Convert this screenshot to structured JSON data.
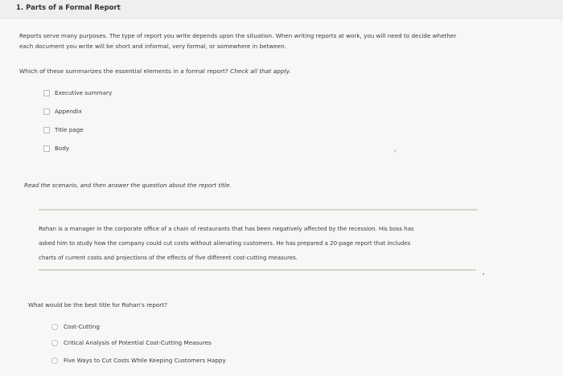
{
  "header": {
    "title": "1. Parts of a Formal Report"
  },
  "intro": {
    "line1": "Reports serve many purposes. The type of report you write depends upon the situation. When writing reports at work, you will need to decide whether",
    "line2": "each document you write will be short and informal, very formal, or somewhere in between."
  },
  "question1": {
    "prompt": "Which of these summarizes the essential elements in a formal report?",
    "hint": "Check all that apply.",
    "options": [
      "Executive summary",
      "Appendix",
      "Title page",
      "Body"
    ]
  },
  "instructions": "Read the scenario, and then answer the question about the report title.",
  "scenario": {
    "line1": "Rohan is a manager in the corporate office of a chain of restaurants that has been negatively affected by the recession. His boss has",
    "line2": "asked him to study how the company could cut costs without alienating customers. He has prepared a 20-page report that includes",
    "line3": "charts of current costs and projections of the effects of five different cost-cutting measures."
  },
  "question2": {
    "prompt": "What would be the best title for Rohan's report?",
    "options": [
      "Cost-Cutting",
      "Critical Analysis of Potential Cost-Cutting Measures",
      "Five Ways to Cut Costs While Keeping Customers Happy"
    ]
  }
}
